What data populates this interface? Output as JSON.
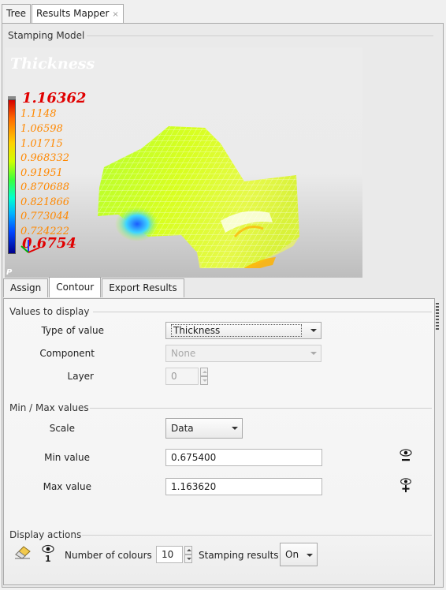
{
  "top_tabs": [
    {
      "label": "Tree"
    },
    {
      "label": "Results Mapper",
      "close": "×"
    }
  ],
  "panel": {
    "title": "Stamping Model"
  },
  "viewer": {
    "title": "Thickness",
    "legend_max": "1.16362",
    "legend_values": [
      "1.1148",
      "1.06598",
      "1.01715",
      "0.968332",
      "0.91951",
      "0.870688",
      "0.821866",
      "0.773044",
      "0.724222"
    ],
    "legend_min": "0.6754",
    "axis_label": "P"
  },
  "sub_tabs": [
    {
      "label": "Assign"
    },
    {
      "label": "Contour"
    },
    {
      "label": "Export Results"
    }
  ],
  "values_to_display": {
    "heading": "Values to display",
    "type_label": "Type of value",
    "type_value": "Thickness",
    "component_label": "Component",
    "component_value": "None",
    "layer_label": "Layer",
    "layer_value": "0"
  },
  "minmax": {
    "heading": "Min / Max values",
    "scale_label": "Scale",
    "scale_value": "Data",
    "min_label": "Min value",
    "min_value": "0.675400",
    "max_label": "Max value",
    "max_value": "1.163620"
  },
  "display_actions": {
    "heading": "Display actions",
    "eye_count": "1",
    "colours_label": "Number of colours",
    "colours_value": "10",
    "stamping_label": "Stamping results",
    "stamping_value": "On"
  }
}
